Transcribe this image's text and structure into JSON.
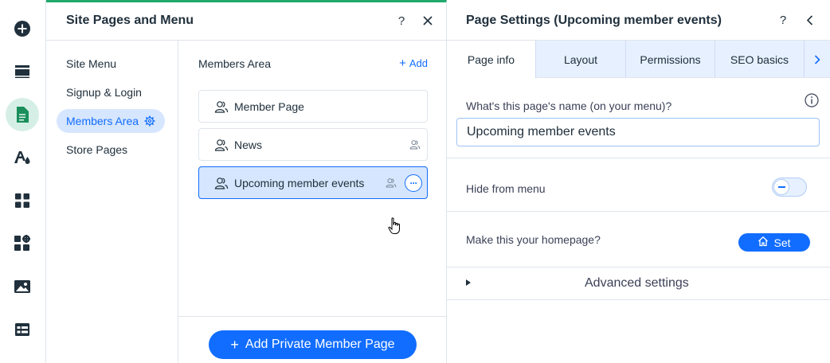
{
  "rail": {
    "items": [
      {
        "icon": "add-icon"
      },
      {
        "icon": "sections-icon"
      },
      {
        "icon": "pages-icon",
        "active": true
      },
      {
        "icon": "design-icon"
      },
      {
        "icon": "apps-icon"
      },
      {
        "icon": "business-apps-icon"
      },
      {
        "icon": "media-icon"
      },
      {
        "icon": "cms-icon"
      }
    ]
  },
  "site_panel": {
    "title": "Site Pages and Menu",
    "help_label": "?",
    "close_label": "✕",
    "menu": [
      {
        "label": "Site Menu",
        "selected": false
      },
      {
        "label": "Signup & Login",
        "selected": false
      },
      {
        "label": "Members Area",
        "selected": true
      },
      {
        "label": "Store Pages",
        "selected": false
      }
    ],
    "section_title": "Members Area",
    "add_label": "Add",
    "pages": [
      {
        "label": "Member Page",
        "private": false,
        "selected": false
      },
      {
        "label": "News",
        "private": true,
        "selected": false
      },
      {
        "label": "Upcoming member events",
        "private": true,
        "selected": true
      }
    ],
    "more_label": "···",
    "add_private_label": "Add Private Member Page"
  },
  "settings_panel": {
    "title": "Page Settings (Upcoming member events)",
    "help_label": "?",
    "back_label": "‹",
    "tabs": [
      {
        "label": "Page info",
        "active": true
      },
      {
        "label": "Layout",
        "active": false
      },
      {
        "label": "Permissions",
        "active": false
      },
      {
        "label": "SEO basics",
        "active": false
      }
    ],
    "name_label": "What's this page's name (on your menu)?",
    "name_value": "Upcoming member events",
    "hide_label": "Hide from menu",
    "hide_value": false,
    "homepage_label": "Make this your homepage?",
    "set_label": "Set",
    "advanced_label": "Advanced settings"
  },
  "colors": {
    "accent": "#116dff",
    "selection": "#d6e6fe",
    "panel_accent": "#21a96b",
    "tab_bg": "#e7f0ff"
  }
}
